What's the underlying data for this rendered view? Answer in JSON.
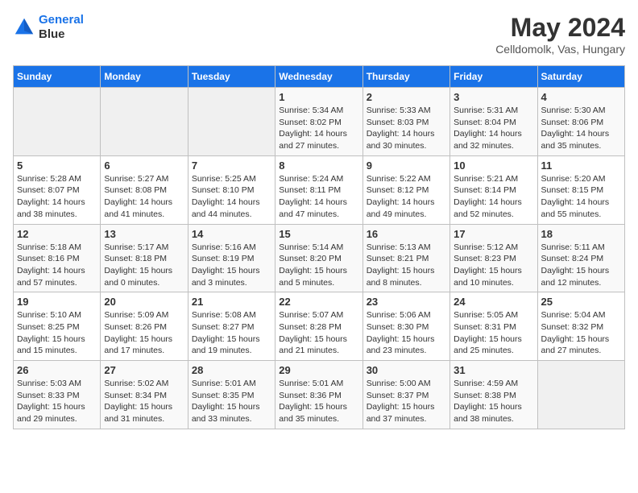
{
  "header": {
    "logo_line1": "General",
    "logo_line2": "Blue",
    "month_title": "May 2024",
    "subtitle": "Celldomolk, Vas, Hungary"
  },
  "calendar": {
    "weekdays": [
      "Sunday",
      "Monday",
      "Tuesday",
      "Wednesday",
      "Thursday",
      "Friday",
      "Saturday"
    ],
    "weeks": [
      [
        {
          "day": "",
          "info": ""
        },
        {
          "day": "",
          "info": ""
        },
        {
          "day": "",
          "info": ""
        },
        {
          "day": "1",
          "info": "Sunrise: 5:34 AM\nSunset: 8:02 PM\nDaylight: 14 hours\nand 27 minutes."
        },
        {
          "day": "2",
          "info": "Sunrise: 5:33 AM\nSunset: 8:03 PM\nDaylight: 14 hours\nand 30 minutes."
        },
        {
          "day": "3",
          "info": "Sunrise: 5:31 AM\nSunset: 8:04 PM\nDaylight: 14 hours\nand 32 minutes."
        },
        {
          "day": "4",
          "info": "Sunrise: 5:30 AM\nSunset: 8:06 PM\nDaylight: 14 hours\nand 35 minutes."
        }
      ],
      [
        {
          "day": "5",
          "info": "Sunrise: 5:28 AM\nSunset: 8:07 PM\nDaylight: 14 hours\nand 38 minutes."
        },
        {
          "day": "6",
          "info": "Sunrise: 5:27 AM\nSunset: 8:08 PM\nDaylight: 14 hours\nand 41 minutes."
        },
        {
          "day": "7",
          "info": "Sunrise: 5:25 AM\nSunset: 8:10 PM\nDaylight: 14 hours\nand 44 minutes."
        },
        {
          "day": "8",
          "info": "Sunrise: 5:24 AM\nSunset: 8:11 PM\nDaylight: 14 hours\nand 47 minutes."
        },
        {
          "day": "9",
          "info": "Sunrise: 5:22 AM\nSunset: 8:12 PM\nDaylight: 14 hours\nand 49 minutes."
        },
        {
          "day": "10",
          "info": "Sunrise: 5:21 AM\nSunset: 8:14 PM\nDaylight: 14 hours\nand 52 minutes."
        },
        {
          "day": "11",
          "info": "Sunrise: 5:20 AM\nSunset: 8:15 PM\nDaylight: 14 hours\nand 55 minutes."
        }
      ],
      [
        {
          "day": "12",
          "info": "Sunrise: 5:18 AM\nSunset: 8:16 PM\nDaylight: 14 hours\nand 57 minutes."
        },
        {
          "day": "13",
          "info": "Sunrise: 5:17 AM\nSunset: 8:18 PM\nDaylight: 15 hours\nand 0 minutes."
        },
        {
          "day": "14",
          "info": "Sunrise: 5:16 AM\nSunset: 8:19 PM\nDaylight: 15 hours\nand 3 minutes."
        },
        {
          "day": "15",
          "info": "Sunrise: 5:14 AM\nSunset: 8:20 PM\nDaylight: 15 hours\nand 5 minutes."
        },
        {
          "day": "16",
          "info": "Sunrise: 5:13 AM\nSunset: 8:21 PM\nDaylight: 15 hours\nand 8 minutes."
        },
        {
          "day": "17",
          "info": "Sunrise: 5:12 AM\nSunset: 8:23 PM\nDaylight: 15 hours\nand 10 minutes."
        },
        {
          "day": "18",
          "info": "Sunrise: 5:11 AM\nSunset: 8:24 PM\nDaylight: 15 hours\nand 12 minutes."
        }
      ],
      [
        {
          "day": "19",
          "info": "Sunrise: 5:10 AM\nSunset: 8:25 PM\nDaylight: 15 hours\nand 15 minutes."
        },
        {
          "day": "20",
          "info": "Sunrise: 5:09 AM\nSunset: 8:26 PM\nDaylight: 15 hours\nand 17 minutes."
        },
        {
          "day": "21",
          "info": "Sunrise: 5:08 AM\nSunset: 8:27 PM\nDaylight: 15 hours\nand 19 minutes."
        },
        {
          "day": "22",
          "info": "Sunrise: 5:07 AM\nSunset: 8:28 PM\nDaylight: 15 hours\nand 21 minutes."
        },
        {
          "day": "23",
          "info": "Sunrise: 5:06 AM\nSunset: 8:30 PM\nDaylight: 15 hours\nand 23 minutes."
        },
        {
          "day": "24",
          "info": "Sunrise: 5:05 AM\nSunset: 8:31 PM\nDaylight: 15 hours\nand 25 minutes."
        },
        {
          "day": "25",
          "info": "Sunrise: 5:04 AM\nSunset: 8:32 PM\nDaylight: 15 hours\nand 27 minutes."
        }
      ],
      [
        {
          "day": "26",
          "info": "Sunrise: 5:03 AM\nSunset: 8:33 PM\nDaylight: 15 hours\nand 29 minutes."
        },
        {
          "day": "27",
          "info": "Sunrise: 5:02 AM\nSunset: 8:34 PM\nDaylight: 15 hours\nand 31 minutes."
        },
        {
          "day": "28",
          "info": "Sunrise: 5:01 AM\nSunset: 8:35 PM\nDaylight: 15 hours\nand 33 minutes."
        },
        {
          "day": "29",
          "info": "Sunrise: 5:01 AM\nSunset: 8:36 PM\nDaylight: 15 hours\nand 35 minutes."
        },
        {
          "day": "30",
          "info": "Sunrise: 5:00 AM\nSunset: 8:37 PM\nDaylight: 15 hours\nand 37 minutes."
        },
        {
          "day": "31",
          "info": "Sunrise: 4:59 AM\nSunset: 8:38 PM\nDaylight: 15 hours\nand 38 minutes."
        },
        {
          "day": "",
          "info": ""
        }
      ]
    ]
  }
}
